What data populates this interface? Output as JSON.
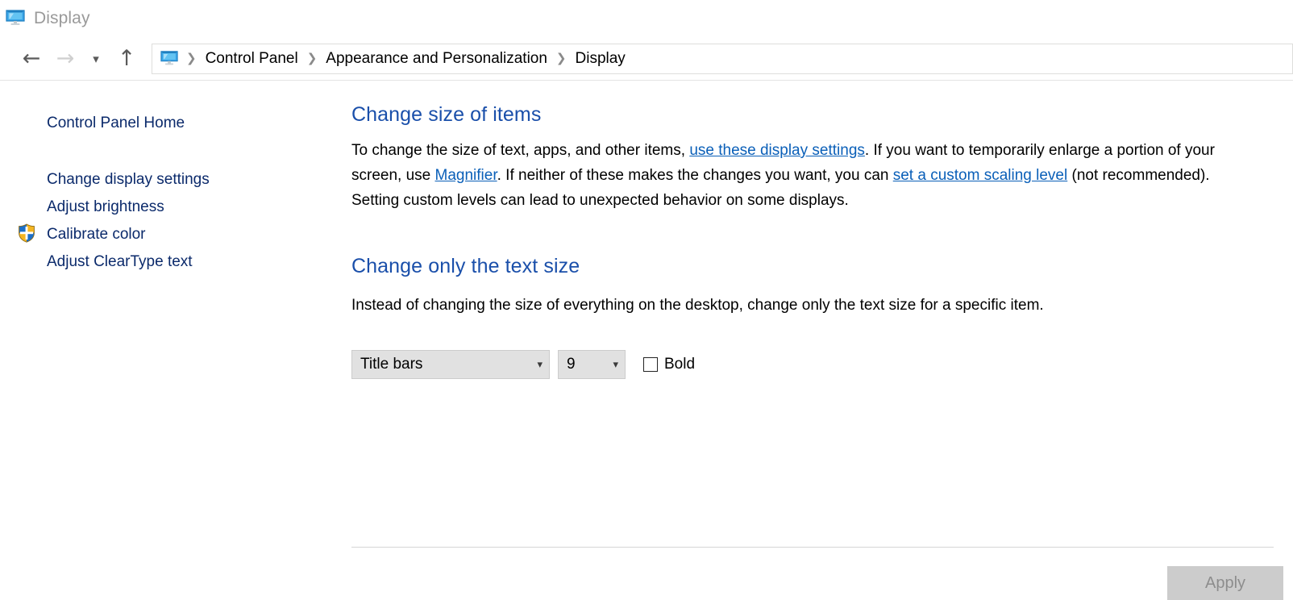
{
  "window": {
    "title": "Display",
    "title_icon": "monitor-icon"
  },
  "navigation": {
    "back_icon": "back-arrow-icon",
    "forward_icon": "forward-arrow-icon",
    "recent_icon": "chevron-down-icon",
    "up_icon": "up-arrow-icon",
    "address_icon": "monitor-icon",
    "breadcrumbs": [
      {
        "label": "Control Panel"
      },
      {
        "label": "Appearance and Personalization"
      },
      {
        "label": "Display"
      }
    ],
    "separator": "❯"
  },
  "sidebar": {
    "home_label": "Control Panel Home",
    "items": [
      {
        "label": "Change display settings",
        "icon": null
      },
      {
        "label": "Adjust brightness",
        "icon": null
      },
      {
        "label": "Calibrate color",
        "icon": "uac-shield-icon"
      },
      {
        "label": "Adjust ClearType text",
        "icon": null
      }
    ]
  },
  "main": {
    "section_one": {
      "heading": "Change size of items",
      "text_part_1": "To change the size of text, apps, and other items, ",
      "link_1": "use these display settings",
      "text_part_2": ".  If you want to temporarily enlarge a portion of your screen, use ",
      "link_2": "Magnifier",
      "text_part_3": ".  If neither of these makes the changes you want, you can ",
      "link_3": "set a custom scaling level",
      "text_part_4": " (not recommended).  Setting custom levels can lead to unexpected behavior on some displays."
    },
    "section_two": {
      "heading": "Change only the text size",
      "description": "Instead of changing the size of everything on the desktop, change only the text size for a specific item."
    },
    "controls": {
      "item_select_value": "Title bars",
      "size_select_value": "9",
      "bold_label": "Bold",
      "bold_checked": false,
      "caret": "⌵"
    },
    "apply_label": "Apply"
  },
  "colors": {
    "heading_blue": "#1a4faa",
    "link_blue": "#0a5fb8",
    "sidebar_blue": "#0b2a6b",
    "titlebar_gray": "#9a9a9a",
    "disabled_gray": "#8d8d8d"
  }
}
